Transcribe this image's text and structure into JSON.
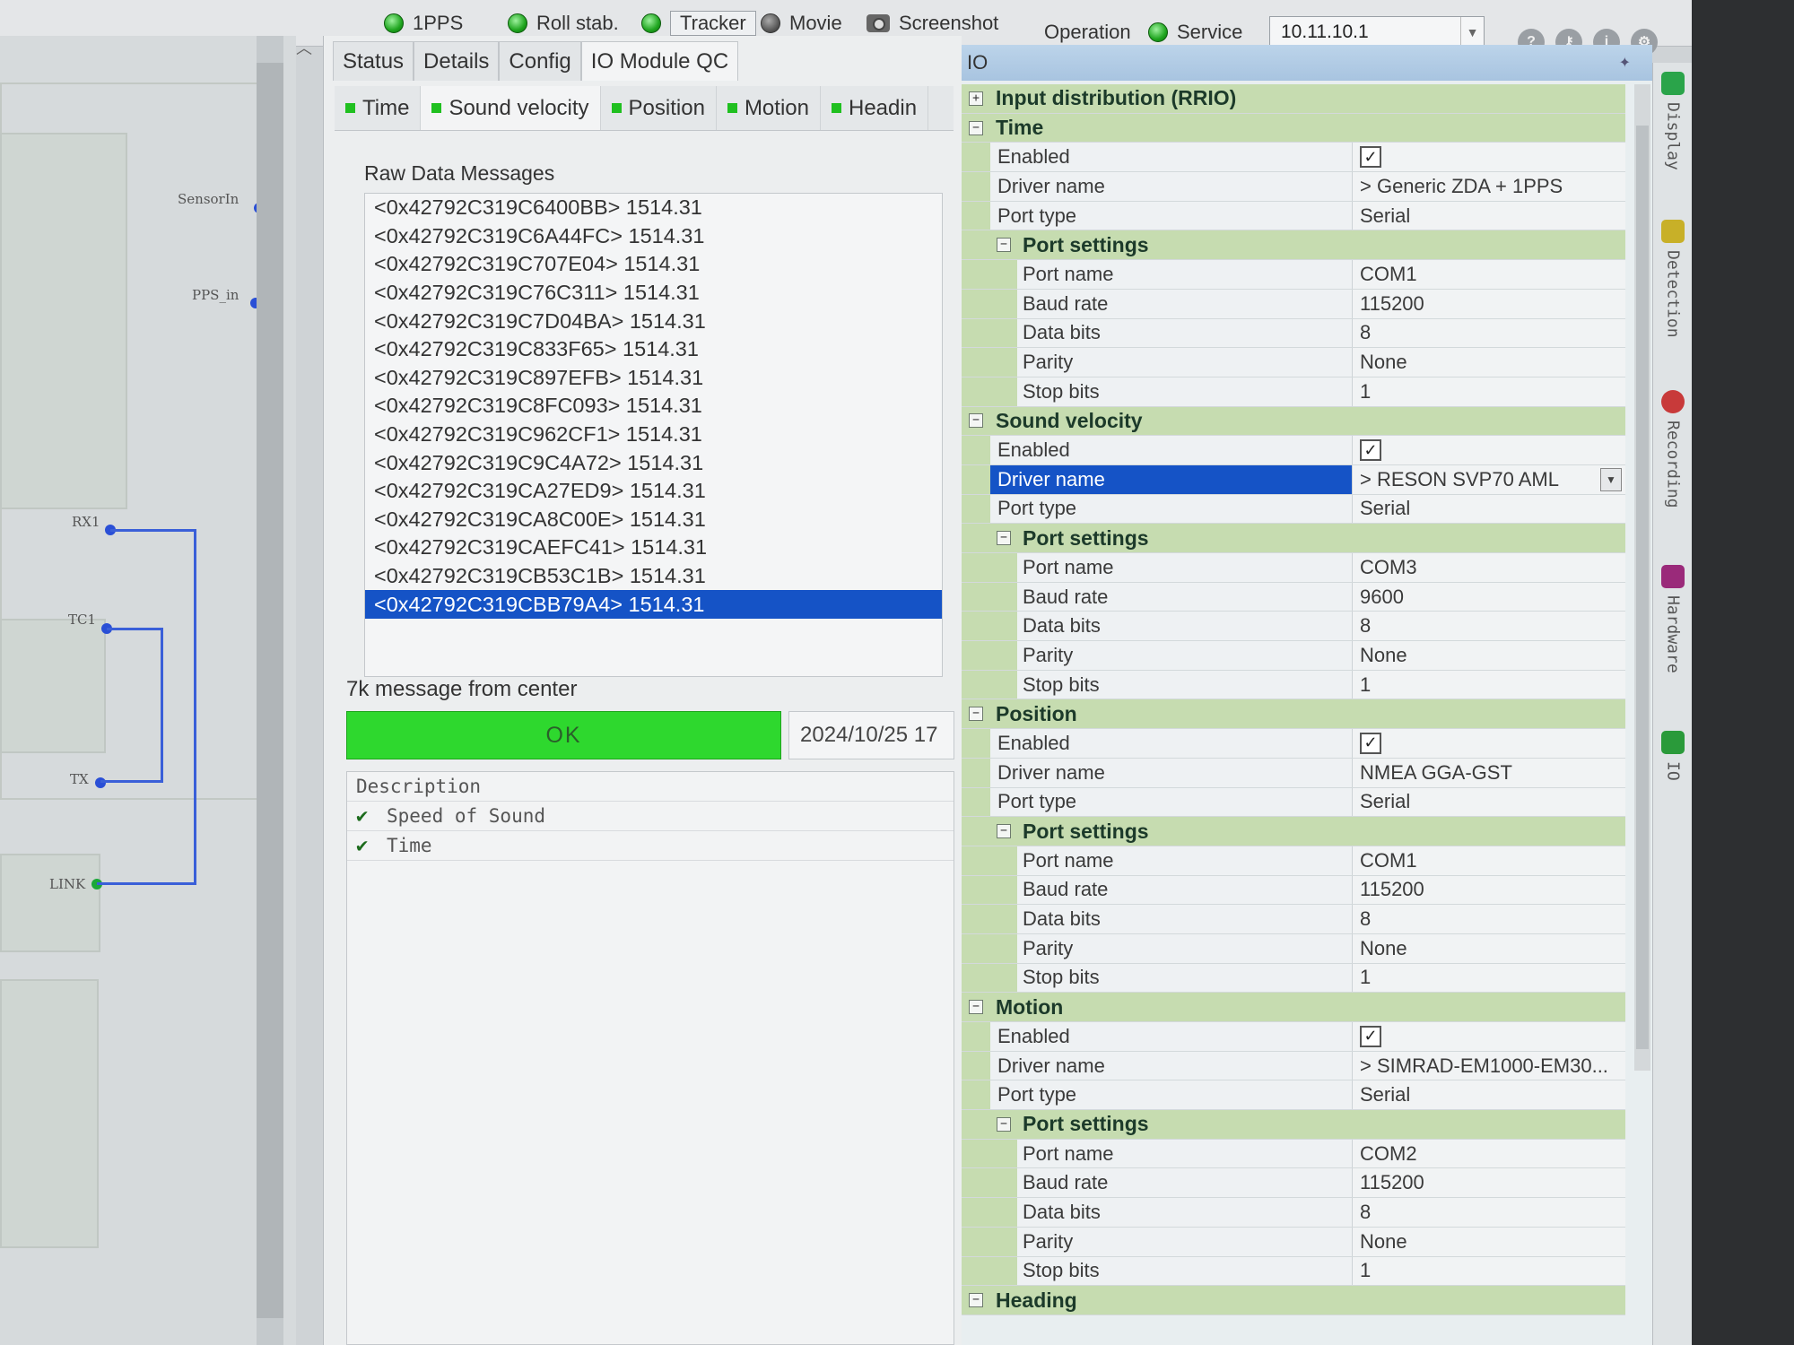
{
  "toolbar": {
    "pps_label": "1PPS",
    "roll_label": "Roll stab.",
    "tracker_label": "Tracker",
    "movie_label": "Movie",
    "screenshot_label": "Screenshot",
    "operation_label": "Operation",
    "service_label": "Service",
    "ip_value": "10.11.10.1"
  },
  "schematic": {
    "labels": [
      "SensorIn",
      "PPS_in",
      "RX1",
      "TC1",
      "TX",
      "LINK"
    ]
  },
  "tabs": {
    "main": [
      "Status",
      "Details",
      "Config",
      "IO Module QC"
    ],
    "sub": [
      "Time",
      "Sound velocity",
      "Position",
      "Motion",
      "Headin"
    ]
  },
  "raw": {
    "title": "Raw Data Messages",
    "messages": [
      "<0x42792C319C6400BB> 1514.31",
      "<0x42792C319C6A44FC> 1514.31",
      "<0x42792C319C707E04> 1514.31",
      "<0x42792C319C76C311> 1514.31",
      "<0x42792C319C7D04BA> 1514.31",
      "<0x42792C319C833F65> 1514.31",
      "<0x42792C319C897EFB> 1514.31",
      "<0x42792C319C8FC093> 1514.31",
      "<0x42792C319C962CF1> 1514.31",
      "<0x42792C319C9C4A72> 1514.31",
      "<0x42792C319CA27ED9> 1514.31",
      "<0x42792C319CA8C00E> 1514.31",
      "<0x42792C319CAEFC41> 1514.31",
      "<0x42792C319CB53C1B> 1514.31",
      "<0x42792C319CBB79A4> 1514.31"
    ]
  },
  "message": {
    "label": "7k message from center",
    "status": "OK",
    "timestamp": "2024/10/25 17"
  },
  "description": {
    "header": "Description",
    "items": [
      "Speed of Sound",
      "Time"
    ]
  },
  "io": {
    "title": "IO",
    "root": "Input distribution (RRIO)",
    "labels": {
      "enabled": "Enabled",
      "driver": "Driver name",
      "port_type": "Port type",
      "port_settings": "Port settings",
      "port_name": "Port name",
      "baud": "Baud rate",
      "data_bits": "Data bits",
      "parity": "Parity",
      "stop_bits": "Stop bits"
    },
    "sections": [
      {
        "name": "Time",
        "driver": "> Generic ZDA + 1PPS",
        "port_type": "Serial",
        "port_name": "COM1",
        "baud": "115200",
        "data_bits": "8",
        "parity": "None",
        "stop_bits": "1"
      },
      {
        "name": "Sound velocity",
        "driver": "> RESON SVP70 AML",
        "port_type": "Serial",
        "port_name": "COM3",
        "baud": "9600",
        "data_bits": "8",
        "parity": "None",
        "stop_bits": "1"
      },
      {
        "name": "Position",
        "driver": "NMEA GGA-GST",
        "port_type": "Serial",
        "port_name": "COM1",
        "baud": "115200",
        "data_bits": "8",
        "parity": "None",
        "stop_bits": "1"
      },
      {
        "name": "Motion",
        "driver": "> SIMRAD-EM1000-EM30...",
        "port_type": "Serial",
        "port_name": "COM2",
        "baud": "115200",
        "data_bits": "8",
        "parity": "None",
        "stop_bits": "1"
      }
    ],
    "last_section": "Heading"
  },
  "side_tabs": [
    "Display",
    "Detection",
    "Recording",
    "Hardware",
    "IO"
  ]
}
